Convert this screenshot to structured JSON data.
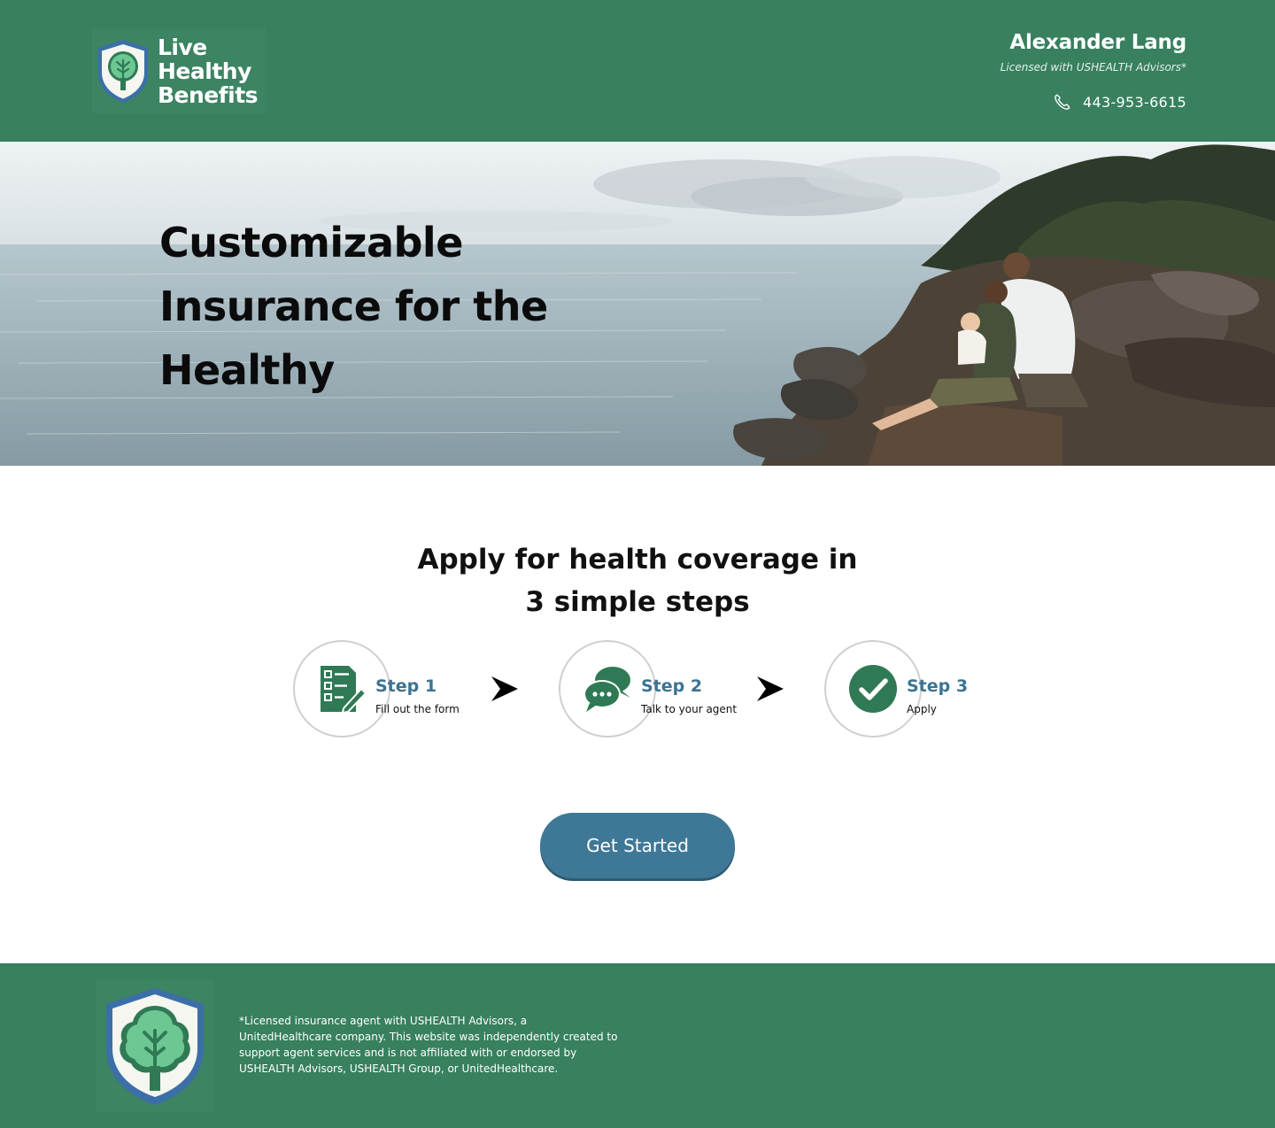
{
  "header": {
    "logo_lines": [
      "Live",
      "Healthy",
      "Benefits"
    ],
    "agent_name": "Alexander Lang",
    "agent_license": "Licensed with USHEALTH Advisors*",
    "phone": "443-953-6615",
    "phone_icon": "phone-icon"
  },
  "hero": {
    "title": "Customizable Insurance for the Healthy"
  },
  "steps": {
    "heading_line1": "Apply for health coverage in",
    "heading_line2": "3 simple steps",
    "items": [
      {
        "title": "Step 1",
        "subtitle": "Fill out the form",
        "icon": "form-icon"
      },
      {
        "title": "Step 2",
        "subtitle": "Talk to your agent",
        "icon": "chat-icon"
      },
      {
        "title": "Step 3",
        "subtitle": "Apply",
        "icon": "checkmark-icon"
      }
    ]
  },
  "cta": {
    "label": "Get Started"
  },
  "footer": {
    "disclaimer": "*Licensed insurance agent with USHEALTH Advisors, a UnitedHealthcare company. This website was independently created to support agent services and is not affiliated with or endorsed by USHEALTH Advisors, USHEALTH Group, or UnitedHealthcare."
  },
  "colors": {
    "brand_green": "#38805e",
    "step_blue": "#3b7392",
    "button_blue": "#3f7896",
    "icon_green": "#2f7a55"
  }
}
